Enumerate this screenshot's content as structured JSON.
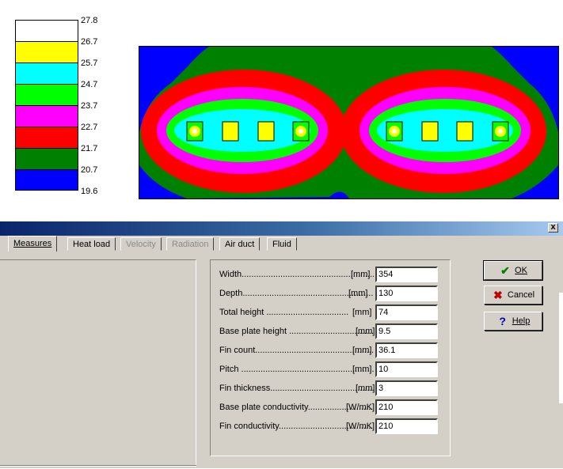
{
  "legend": {
    "labels": [
      "27.8",
      "26.7",
      "25.7",
      "24.7",
      "23.7",
      "22.7",
      "21.7",
      "20.7",
      "19.6"
    ],
    "colors": [
      "#ffffff",
      "#ffff00",
      "#00ffff",
      "#00ff00",
      "#ff00ff",
      "#ff0000",
      "#008000",
      "#0000ff"
    ]
  },
  "plot": {
    "component_count": 8
  },
  "dialog": {
    "close_label": "x",
    "tabs": [
      {
        "label": "Measures",
        "active": true,
        "disabled": false
      },
      {
        "label": "Heat load",
        "active": false,
        "disabled": false
      },
      {
        "label": "Velocity",
        "active": false,
        "disabled": true
      },
      {
        "label": "Radiation",
        "active": false,
        "disabled": true
      },
      {
        "label": "Air duct",
        "active": false,
        "disabled": false
      },
      {
        "label": "Fluid",
        "active": false,
        "disabled": false
      }
    ],
    "params": [
      {
        "label": "Width",
        "unit": "[mm]",
        "value": "354"
      },
      {
        "label": "Depth",
        "unit": "[mm]",
        "value": "130"
      },
      {
        "label": "Total height",
        "unit": "[mm]",
        "value": "74"
      },
      {
        "label": "Base plate height",
        "unit": "[mm]",
        "value": "9.5"
      },
      {
        "label": "Fin count",
        "unit": "[mm]",
        "value": "36.1"
      },
      {
        "label": "Pitch",
        "unit": "[mm]",
        "value": "10"
      },
      {
        "label": "Fin thickness",
        "unit": "[mm]",
        "value": "3"
      },
      {
        "label": "Base plate conductivity",
        "unit": "[W/mK]",
        "value": "210"
      },
      {
        "label": "Fin conductivity",
        "unit": "[W/mK]",
        "value": "210"
      }
    ],
    "buttons": {
      "ok": "OK",
      "cancel": "Cancel",
      "help": "Help"
    }
  }
}
